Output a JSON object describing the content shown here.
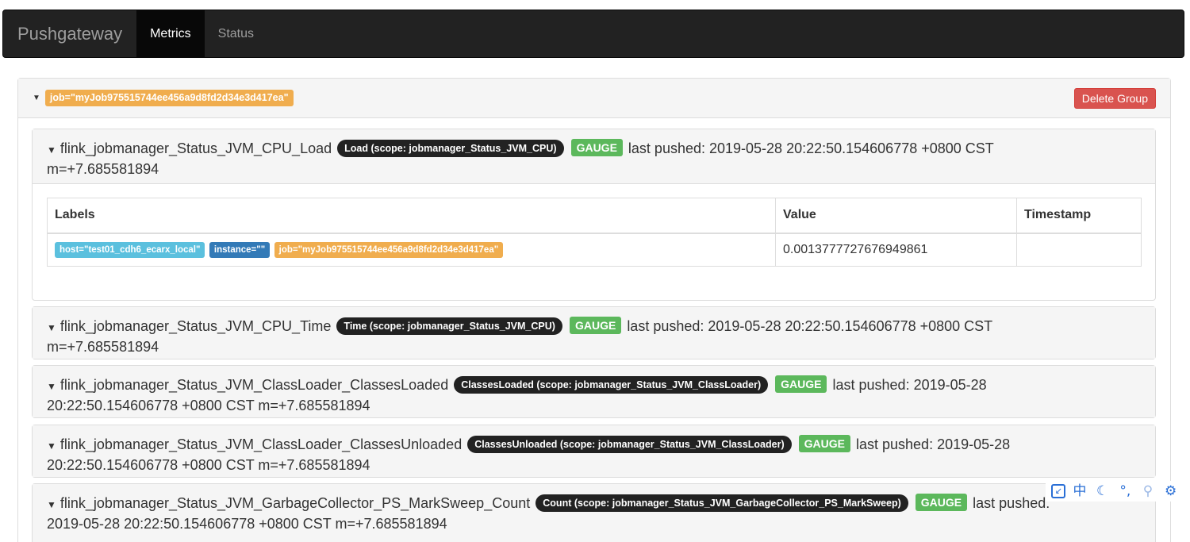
{
  "navbar": {
    "brand": "Pushgateway",
    "items": [
      {
        "label": "Metrics",
        "active": true
      },
      {
        "label": "Status",
        "active": false
      }
    ]
  },
  "group": {
    "job_label": "job=\"myJob975515744ee456a9d8fd2d34e3d417ea\"",
    "delete_button": "Delete Group"
  },
  "metrics": [
    {
      "name": "flink_jobmanager_Status_JVM_CPU_Load",
      "help": "Load (scope: jobmanager_Status_JVM_CPU)",
      "type": "GAUGE",
      "pushed_text": "last pushed: 2019-05-28 20:22:50.154606778 +0800 CST",
      "second_line": "m=+7.685581894"
    },
    {
      "name": "flink_jobmanager_Status_JVM_CPU_Time",
      "help": "Time (scope: jobmanager_Status_JVM_CPU)",
      "type": "GAUGE",
      "pushed_text": "last pushed: 2019-05-28 20:22:50.154606778 +0800 CST",
      "second_line": "m=+7.685581894"
    },
    {
      "name": "flink_jobmanager_Status_JVM_ClassLoader_ClassesLoaded",
      "help": "ClassesLoaded (scope: jobmanager_Status_JVM_ClassLoader)",
      "type": "GAUGE",
      "pushed_text": "last pushed: 2019-05-28",
      "second_line": "20:22:50.154606778 +0800 CST m=+7.685581894"
    },
    {
      "name": "flink_jobmanager_Status_JVM_ClassLoader_ClassesUnloaded",
      "help": "ClassesUnloaded (scope: jobmanager_Status_JVM_ClassLoader)",
      "type": "GAUGE",
      "pushed_text": "last pushed: 2019-05-28",
      "second_line": "20:22:50.154606778 +0800 CST m=+7.685581894"
    },
    {
      "name": "flink_jobmanager_Status_JVM_GarbageCollector_PS_MarkSweep_Count",
      "help": "Count (scope: jobmanager_Status_JVM_GarbageCollector_PS_MarkSweep)",
      "type": "GAUGE",
      "pushed_text": "last pushed:",
      "second_line": "2019-05-28 20:22:50.154606778 +0800 CST m=+7.685581894"
    }
  ],
  "table": {
    "headers": {
      "labels": "Labels",
      "value": "Value",
      "timestamp": "Timestamp"
    },
    "row": {
      "labels": [
        {
          "text": "host=\"test01_cdh6_ecarx_local\"",
          "color": "#5bc0de"
        },
        {
          "text": "instance=\"\"",
          "color": "#337ab7"
        },
        {
          "text": "job=\"myJob975515744ee456a9d8fd2d34e3d417ea\"",
          "color": "#f0ad4e"
        }
      ],
      "value": "0.0013777727676949861",
      "timestamp": ""
    }
  },
  "toolbar": {
    "icons": [
      "expand-icon",
      "chinese-input-icon",
      "moon-icon",
      "punctuation-icon",
      "user-icon",
      "settings-icon"
    ],
    "chinese_char": "中"
  }
}
